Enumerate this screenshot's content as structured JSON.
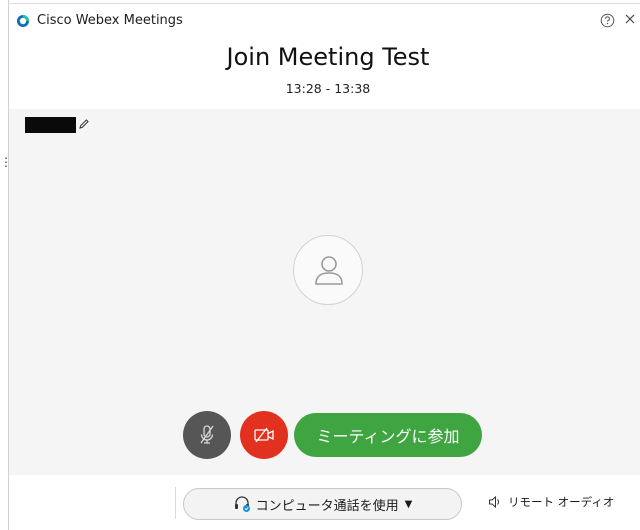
{
  "window": {
    "app_title": "Cisco Webex Meetings",
    "controls": [
      "help-icon",
      "close-icon"
    ]
  },
  "meeting": {
    "title": "Join Meeting Test",
    "time": "13:28 - 13:38"
  },
  "preview": {
    "user_name": "",
    "name_redacted": true,
    "avatar_icon": "person-icon"
  },
  "controls": {
    "mute_icon": "mic-muted-icon",
    "video_icon": "video-off-icon",
    "join_label": "ミーティングに参加"
  },
  "audio": {
    "selected_option": "コンピュータ通話を使用",
    "remote_label": "リモート オーディオ"
  },
  "colors": {
    "join_green": "#3fa540",
    "video_red": "#e2321f",
    "mute_gray": "#565656",
    "preview_bg": "#f5f5f5"
  }
}
